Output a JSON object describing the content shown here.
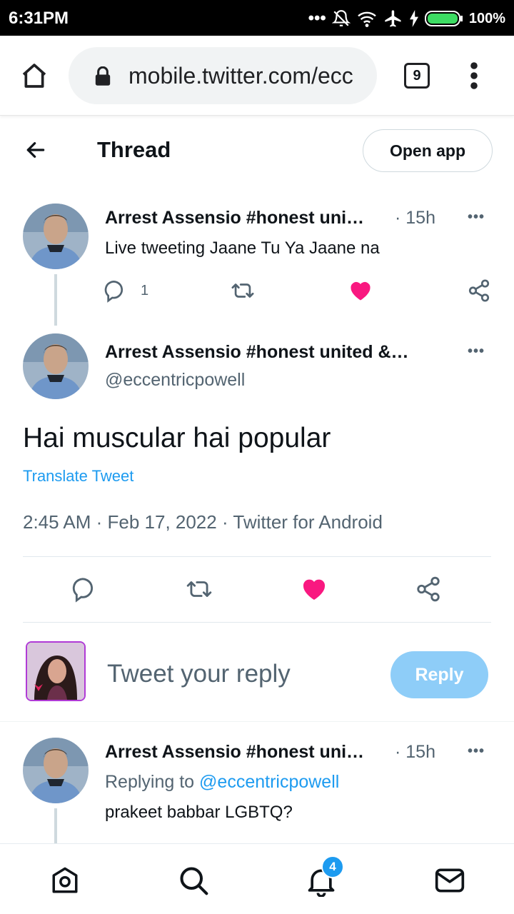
{
  "status_bar": {
    "time": "6:31PM",
    "battery": "100%",
    "icons": [
      "dots-icon",
      "bell-off-icon",
      "wifi-icon",
      "airplane-icon",
      "charging-icon",
      "battery-icon"
    ]
  },
  "browser": {
    "url": "mobile.twitter.com/ecc",
    "tab_count": "9",
    "icons": [
      "home-icon",
      "lock-icon",
      "more-vert-icon"
    ]
  },
  "header": {
    "title": "Thread",
    "open_app_label": "Open app"
  },
  "tweets": [
    {
      "name": "Arrest Assensio #honest uni…",
      "time": "· 15h",
      "text": "Live tweeting Jaane Tu Ya Jaane na",
      "reply_count": "1"
    },
    {
      "name": "Arrest Assensio #honest united &…",
      "handle": "@eccentricpowell",
      "text": "Hai muscular hai popular",
      "translate": "Translate Tweet",
      "meta": "2:45 AM · Feb 17, 2022 · Twitter for Android"
    },
    {
      "name": "Arrest Assensio #honest uni…",
      "time": "· 15h",
      "replying_prefix": "Replying to",
      "replying_handle": "@eccentricpowell",
      "text": "prakeet babbar LGBTQ?"
    }
  ],
  "composer": {
    "placeholder": "Tweet your reply",
    "reply_label": "Reply"
  },
  "bottom_nav": {
    "items": [
      "home-icon",
      "search-icon",
      "notifications-icon",
      "messages-icon"
    ],
    "notification_badge": "4"
  },
  "colors": {
    "like": "#f91880",
    "link": "#1d9bf0",
    "reply_button": "#8ecdf8"
  }
}
